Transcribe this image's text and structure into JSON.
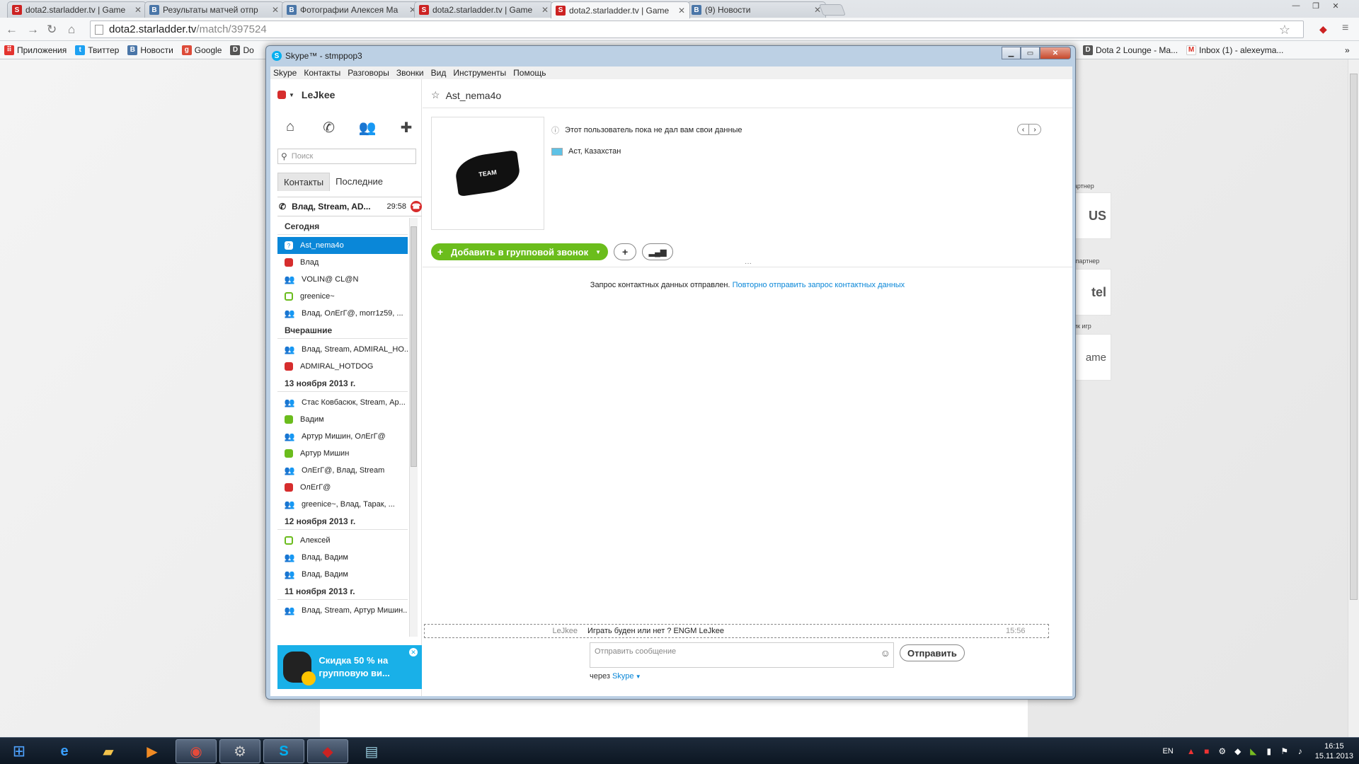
{
  "browser": {
    "tabs": [
      {
        "label": "dota2.starladder.tv | Game",
        "icon": "starladder-icon",
        "color": "#c22"
      },
      {
        "label": "Результаты матчей отпр",
        "icon": "vk-icon",
        "color": "#4a76a8"
      },
      {
        "label": "Фотографии Алексея Ма",
        "icon": "vk-icon",
        "color": "#4a76a8"
      },
      {
        "label": "dota2.starladder.tv | Game",
        "icon": "starladder-icon",
        "color": "#c22"
      },
      {
        "label": "dota2.starladder.tv | Game",
        "icon": "starladder-icon",
        "color": "#c22"
      },
      {
        "label": "(9) Новости",
        "icon": "vk-icon",
        "color": "#4a76a8"
      }
    ],
    "url_host": "dota2.starladder.tv",
    "url_path": "/match/397524",
    "bookmarks": [
      {
        "label": "Приложения",
        "icon": "apps-icon"
      },
      {
        "label": "Твиттер",
        "icon": "twitter-icon"
      },
      {
        "label": "Новости",
        "icon": "vk-icon"
      },
      {
        "label": "Google",
        "icon": "google-plus-icon"
      },
      {
        "label": "Do",
        "icon": "dota-icon"
      },
      {
        "label": "Dota 2 Lounge - Ma...",
        "icon": "dota-icon"
      },
      {
        "label": "Inbox (1) - alexeyma...",
        "icon": "gmail-icon"
      }
    ]
  },
  "sponsors": [
    "партнер",
    "й партнер",
    "ник игр"
  ],
  "sponsor_logos": [
    "US",
    "tel",
    "ame"
  ],
  "skype": {
    "title": "Skype™ - stmppop3",
    "menu": [
      "Skype",
      "Контакты",
      "Разговоры",
      "Звонки",
      "Вид",
      "Инструменты",
      "Помощь"
    ],
    "me": "LeJkee",
    "search_placeholder": "Поиск",
    "tab_contacts": "Контакты",
    "tab_recent": "Последние",
    "active_call": {
      "name": "Влад, Stream, AD...",
      "time": "29:58"
    },
    "groups": [
      {
        "title": "Сегодня",
        "items": [
          {
            "name": "Ast_nema4o",
            "status": "q",
            "selected": true
          },
          {
            "name": "Влад",
            "status": "red"
          },
          {
            "name": "VOLIN@ CL@N",
            "status": "grp3"
          },
          {
            "name": "greenice~",
            "status": "greenring"
          },
          {
            "name": "Влад, ОлЕгГ@, morr1z59, ...",
            "status": "grp3"
          }
        ]
      },
      {
        "title": "Вчерашние",
        "items": [
          {
            "name": "Влад, Stream, ADMIRAL_HO...",
            "status": "grp3"
          },
          {
            "name": "ADMIRAL_HOTDOG",
            "status": "red"
          }
        ]
      },
      {
        "title": "13 ноября 2013 г.",
        "items": [
          {
            "name": "Стас Ковбасюк, Stream, Ар...",
            "status": "grp3"
          },
          {
            "name": "Вадим",
            "status": "green"
          },
          {
            "name": "Артур Мишин, ОлЕгГ@",
            "status": "grp3"
          },
          {
            "name": "Артур Мишин",
            "status": "green"
          },
          {
            "name": "ОлЕгГ@, Влад, Stream",
            "status": "grp3"
          },
          {
            "name": "ОлЕгГ@",
            "status": "red"
          },
          {
            "name": "greenice~, Влад, Тарак, ...",
            "status": "grp3"
          }
        ]
      },
      {
        "title": "12 ноября 2013 г.",
        "items": [
          {
            "name": "Алексей",
            "status": "greenring"
          },
          {
            "name": "Влад, Вадим",
            "status": "grp3"
          },
          {
            "name": "Влад, Вадим",
            "status": "grp3"
          }
        ]
      },
      {
        "title": "11 ноября 2013 г.",
        "items": [
          {
            "name": "Влад, Stream, Артур Мишин...",
            "status": "grp3"
          }
        ]
      }
    ],
    "promo": "Скидка 50 % на групповую ви...",
    "contact": {
      "name": "Ast_nema4o",
      "info": "Этот пользователь пока не дал вам свои данные",
      "location": "Аст, Казахстан",
      "avatar_text": "TEAM"
    },
    "add_group_call": "Добавить в групповой звонок",
    "request_text": "Запрос контактных данных отправлен.",
    "request_link": "Повторно отправить запрос контактных данных",
    "last_message": {
      "from": "LeJkee",
      "text": "Играть буден или нет ? ENGM LeJkee",
      "time": "15:56"
    },
    "compose_placeholder": "Отправить сообщение",
    "send": "Отправить",
    "via": "через",
    "via_link": "Skype"
  },
  "taskbar": {
    "lang": "EN",
    "time": "16:15",
    "date": "15.11.2013"
  }
}
